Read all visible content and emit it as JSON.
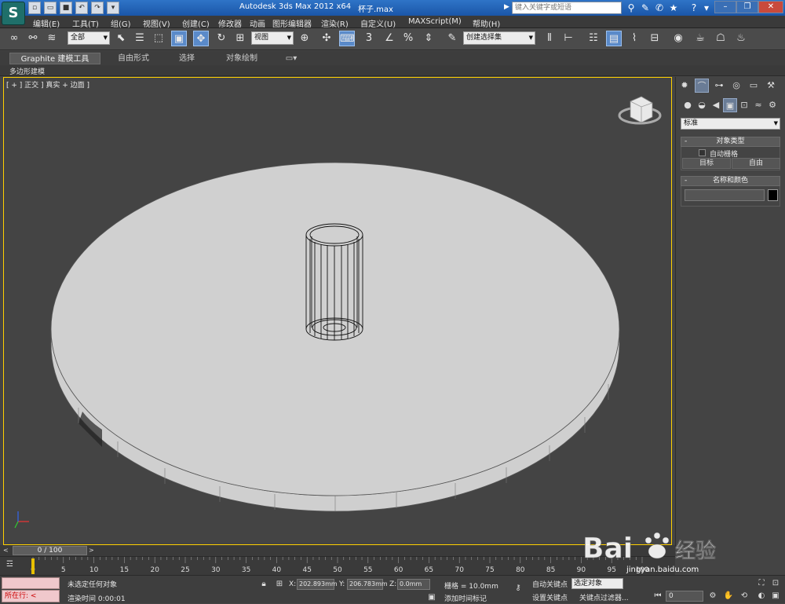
{
  "title_bar": {
    "app_title": "Autodesk 3ds Max  2012 x64",
    "file_name": "杯子.max",
    "search_placeholder": "键入关键字或短语",
    "logo_icon": "3dsmax-logo-icon"
  },
  "menu": {
    "items": [
      "编辑(E)",
      "工具(T)",
      "组(G)",
      "视图(V)",
      "创建(C)",
      "修改器",
      "动画",
      "图形编辑器",
      "渲染(R)",
      "自定义(U)",
      "MAXScript(M)",
      "帮助(H)"
    ]
  },
  "toolbar": {
    "selection_filter": "全部",
    "reference_coord": "视图",
    "named_selection": "创建选择集",
    "snap_label": "3"
  },
  "ribbon": {
    "tabs": [
      "Graphite 建模工具",
      "自由形式",
      "选择",
      "对象绘制"
    ],
    "sub_label": "多边形建模"
  },
  "viewport": {
    "label": "[ + ] 正交 ] 真实 + 边面 ]"
  },
  "command_panel": {
    "category": "标准",
    "object_type": {
      "header": "对象类型",
      "autogrid_label": "自动栅格",
      "buttons": [
        "目标",
        "自由"
      ]
    },
    "name_color": {
      "header": "名称和颜色"
    }
  },
  "time_slider": {
    "position": "0 / 100"
  },
  "timeline": {
    "ticks": [
      "0",
      "5",
      "10",
      "15",
      "20",
      "25",
      "30",
      "35",
      "40",
      "45",
      "50",
      "55",
      "60",
      "65",
      "70",
      "75",
      "80",
      "85",
      "90",
      "95",
      "100"
    ]
  },
  "status": {
    "running_label": "所在行:",
    "selection_status": "未选定任何对象",
    "render_time": "渲染时间  0:00:01",
    "x_label": "X:",
    "x_value": "202.893mm",
    "y_label": "Y:",
    "y_value": "206.783mm",
    "z_label": "Z:",
    "z_value": "0.0mm",
    "grid": "栅格 = 10.0mm",
    "add_time_tag": "添加时间标记",
    "auto_key": "自动关键点",
    "set_key": "设置关键点",
    "selection_mode": "选定对象",
    "key_filters": "关键点过滤器...",
    "frame": "0"
  },
  "watermark": {
    "text": "Baidu 经验",
    "url": "jingyan.baidu.com"
  }
}
